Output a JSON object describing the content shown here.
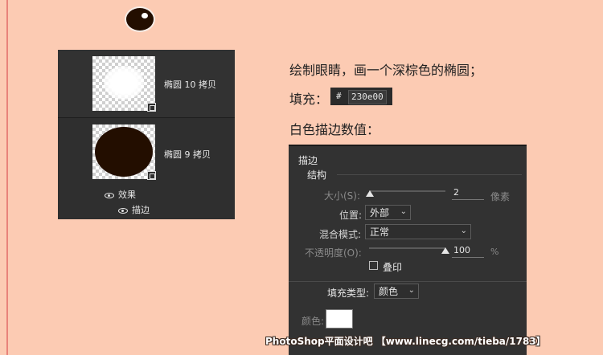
{
  "layers_panel": {
    "layers": [
      {
        "name": "椭圆 10 拷贝"
      },
      {
        "name": "椭圆 9 拷贝"
      }
    ],
    "effects_label": "效果",
    "stroke_effect_label": "描边"
  },
  "instructions": {
    "step": "绘制眼睛，画一个深棕色的椭圆；",
    "fill_label": "填充：",
    "fill_hash": "#",
    "fill_hex": "230e00",
    "stroke_heading": "白色描边数值："
  },
  "colors": {
    "eye_fill": "#230e00",
    "page_background": "#fccbb3",
    "stroke_color": "#ffffff"
  },
  "stroke_dialog": {
    "title": "描边",
    "group": "结构",
    "size": {
      "label": "大小(S):",
      "value": "2",
      "unit": "像素"
    },
    "position": {
      "label": "位置:",
      "value": "外部"
    },
    "blend_mode": {
      "label": "混合模式:",
      "value": "正常"
    },
    "opacity": {
      "label": "不透明度(O):",
      "value": "100",
      "unit": "%"
    },
    "overprint": {
      "label": "叠印",
      "checked": false
    },
    "fill_type": {
      "label": "填充类型:",
      "value": "颜色"
    },
    "color_label": "颜色:"
  },
  "watermark": "PhotoShop平面设计吧  【www.linecg.com/tieba/1783】"
}
